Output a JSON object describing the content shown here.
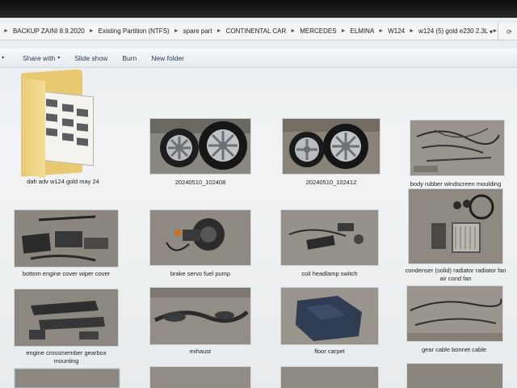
{
  "address": {
    "crumbs": [
      "BACKUP ZAINI 8.9.2020",
      "Existing Partition (NTFS)",
      "spare part",
      "CONTINENTAL CAR",
      "MERCEDES",
      "ELMINA",
      "W124",
      "w124 (5) gold e230 2.3L"
    ]
  },
  "toolbar": {
    "share_label": "Share with",
    "slideshow_label": "Slide show",
    "burn_label": "Burn",
    "newfolder_label": "New folder"
  },
  "items": [
    {
      "caption": "dah adv w124 gold may 24",
      "kind": "folder"
    },
    {
      "caption": "20240510_102408",
      "kind": "image"
    },
    {
      "caption": "20240510_102412",
      "kind": "image"
    },
    {
      "caption": "body rubber windscreen moulding",
      "kind": "image"
    },
    {
      "caption": "bottom engine cover wiper cover",
      "kind": "image"
    },
    {
      "caption": "brake servo fuel pump",
      "kind": "image"
    },
    {
      "caption": "coil headlamp switch",
      "kind": "image"
    },
    {
      "caption": "condenser (solid) radiator radiator fan",
      "caption2": "air cond fan",
      "kind": "image"
    },
    {
      "caption": "engine crossmember gearbox",
      "caption2": "mounting",
      "kind": "image"
    },
    {
      "caption": "exhaust",
      "kind": "image"
    },
    {
      "caption": "floor carpet",
      "kind": "image"
    },
    {
      "caption": "gear cable bonnet cable",
      "kind": "image"
    },
    {
      "caption": "",
      "kind": "image"
    },
    {
      "caption": "",
      "kind": "image"
    },
    {
      "caption": "",
      "kind": "image"
    },
    {
      "caption": "",
      "kind": "image"
    }
  ]
}
